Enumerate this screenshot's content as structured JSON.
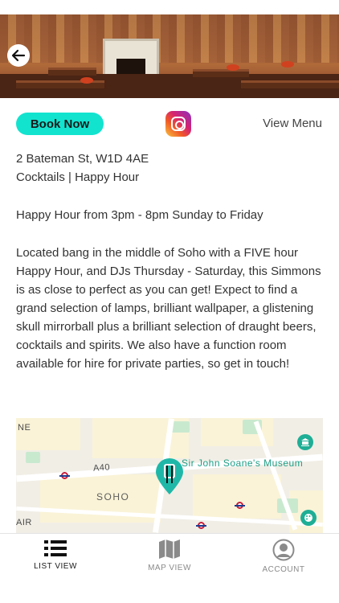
{
  "hero": {
    "back_icon": "arrow-left-icon"
  },
  "actions": {
    "book_label": "Book Now",
    "instagram_icon": "instagram-icon",
    "menu_label": "View Menu",
    "accent_color": "#12e3cf"
  },
  "venue": {
    "address": "2 Bateman St, W1D 4AE",
    "tags": "Cocktails | Happy Hour",
    "happy_hour": "Happy Hour from 3pm - 8pm Sunday to Friday",
    "description": "Located bang in the middle of Soho with a FIVE hour Happy Hour, and DJs Thursday - Saturday, this Simmons is as close to perfect as you can get! Expect to find a grand selection of lamps, brilliant wallpaper, a glistening skull mirrorball plus a brilliant selection of draught beers, cocktails and spirits. We also have a function room available for hire for private parties, so get in touch!"
  },
  "map": {
    "labels": {
      "ne": "NE",
      "road": "A40",
      "soho": "SOHO",
      "air": "AIR",
      "museum": "Sir John Soane's Museum"
    },
    "pin_icon": "cocktail-pin-icon",
    "museum_icon": "museum-icon",
    "palette_icon": "palette-icon"
  },
  "tabbar": {
    "tabs": [
      {
        "label": "LIST VIEW",
        "icon": "list-icon",
        "active": true
      },
      {
        "label": "MAP VIEW",
        "icon": "map-icon",
        "active": false
      },
      {
        "label": "ACCOUNT",
        "icon": "account-icon",
        "active": false
      }
    ]
  }
}
